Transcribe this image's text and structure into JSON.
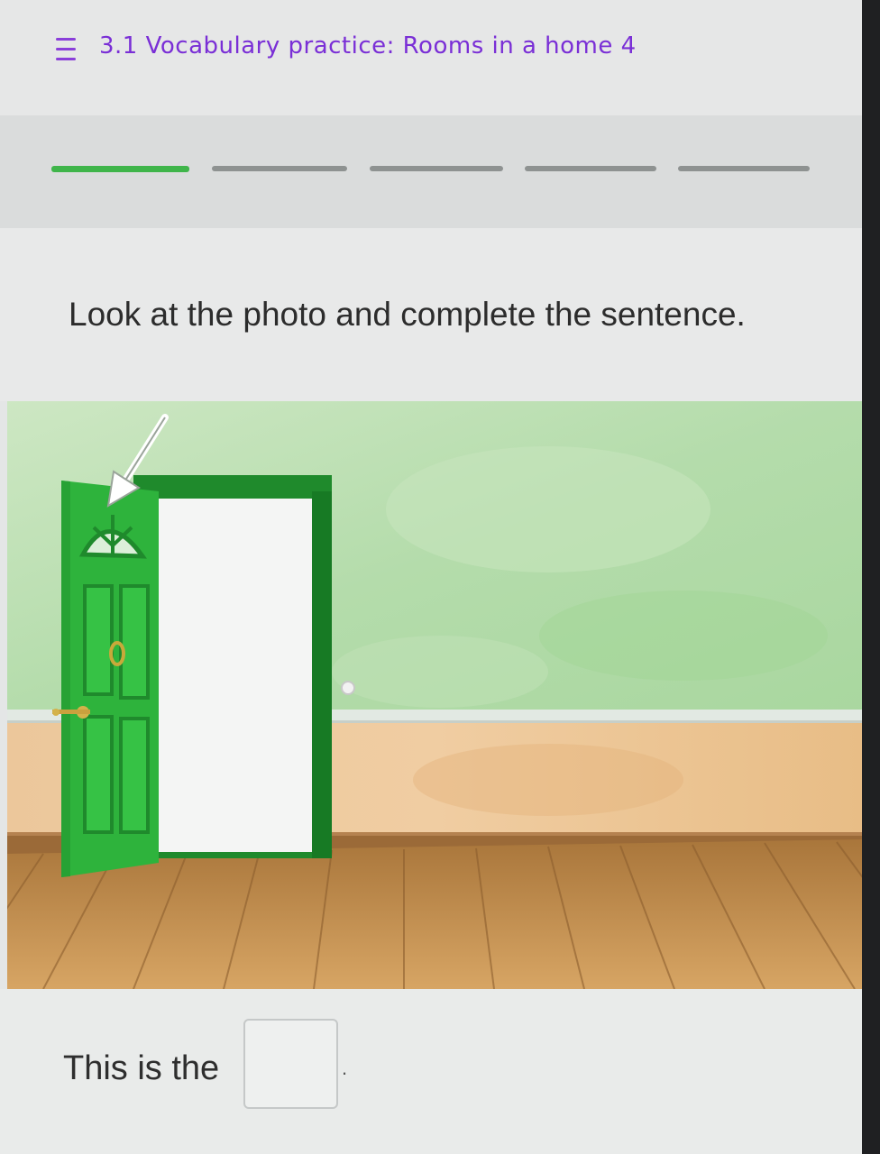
{
  "header": {
    "menu_icon": "hamburger-menu-icon",
    "title": "3.1 Vocabulary practice: Rooms in a home 4"
  },
  "progress": {
    "total_steps": 5,
    "current_step": 1,
    "active_color": "#3fb54a",
    "inactive_color": "#8e9291"
  },
  "question": {
    "instruction": "Look at the photo and complete the sentence.",
    "sentence_prefix": "This is the",
    "answer_value": "",
    "sentence_suffix": "."
  },
  "colors": {
    "title": "#7a2fd6",
    "door": "#2eb33c",
    "wall": "#b9dfb0",
    "floor": "#c08a45"
  }
}
